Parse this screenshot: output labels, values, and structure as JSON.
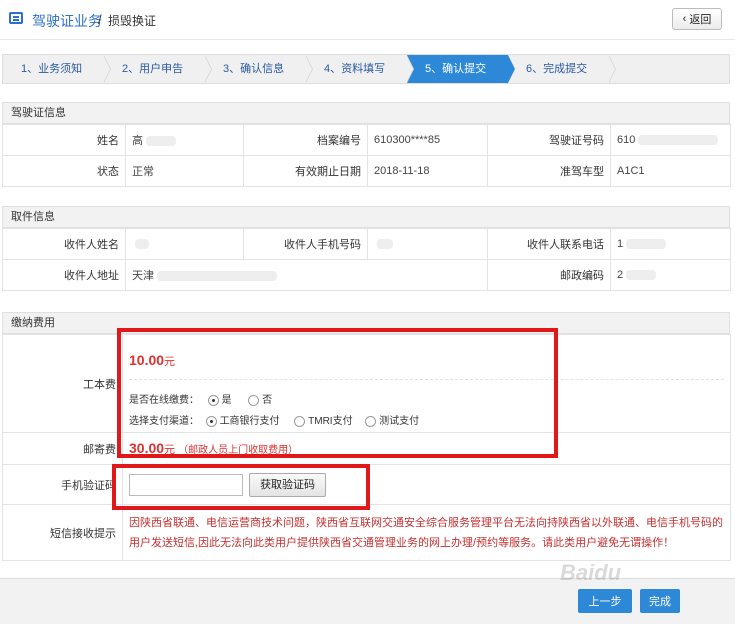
{
  "header": {
    "title": "驾驶证业务",
    "separator": "/",
    "subtitle": "损毁换证",
    "back_label": "返回"
  },
  "steps": [
    "1、业务须知",
    "2、用户申告",
    "3、确认信息",
    "4、资料填写",
    "5、确认提交",
    "6、完成提交"
  ],
  "active_step": 4,
  "license_section": {
    "title": "驾驶证信息",
    "name_label": "姓名",
    "name_value": "高",
    "file_label": "档案编号",
    "file_value": "610300****85",
    "license_label": "驾驶证号码",
    "license_value": "610",
    "status_label": "状态",
    "status_value": "正常",
    "expiry_label": "有效期止日期",
    "expiry_value": "2018-11-18",
    "class_label": "准驾车型",
    "class_value": "A1C1"
  },
  "pickup_section": {
    "title": "取件信息",
    "recipient_label": "收件人姓名",
    "phone_label": "收件人手机号码",
    "contact_label": "收件人联系电话",
    "contact_value": "1",
    "address_label": "收件人地址",
    "address_value": "天津",
    "postcode_label": "邮政编码",
    "postcode_value": "2"
  },
  "fee_section": {
    "title": "缴纳费用",
    "cost_label": "工本费",
    "cost_amount": "10.00",
    "cost_unit": "元",
    "online_pay_label": "是否在线缴费：",
    "online_yes": "是",
    "online_no": "否",
    "channel_label": "选择支付渠道：",
    "channel_1": "工商银行支付",
    "channel_2": "TMRI支付",
    "channel_3": "测试支付",
    "postage_label": "邮寄费",
    "postage_amount": "30.00",
    "postage_unit": "元",
    "postage_note": "（邮政人员上门收取费用）",
    "verify_label": "手机验证码",
    "verify_button": "获取验证码",
    "sms_label": "短信接收提示",
    "sms_text": "因陕西省联通、电信运营商技术问题，陕西省互联网交通安全综合服务管理平台无法向持陕西省以外联通、电信手机号码的用户发送短信,因此无法向此类用户提供陕西省交通管理业务的网上办理/预约等服务。请此类用户避免无谓操作！"
  },
  "footer": {
    "prev_label": "上一步",
    "done_label": "完成"
  },
  "watermark": "Baidu"
}
